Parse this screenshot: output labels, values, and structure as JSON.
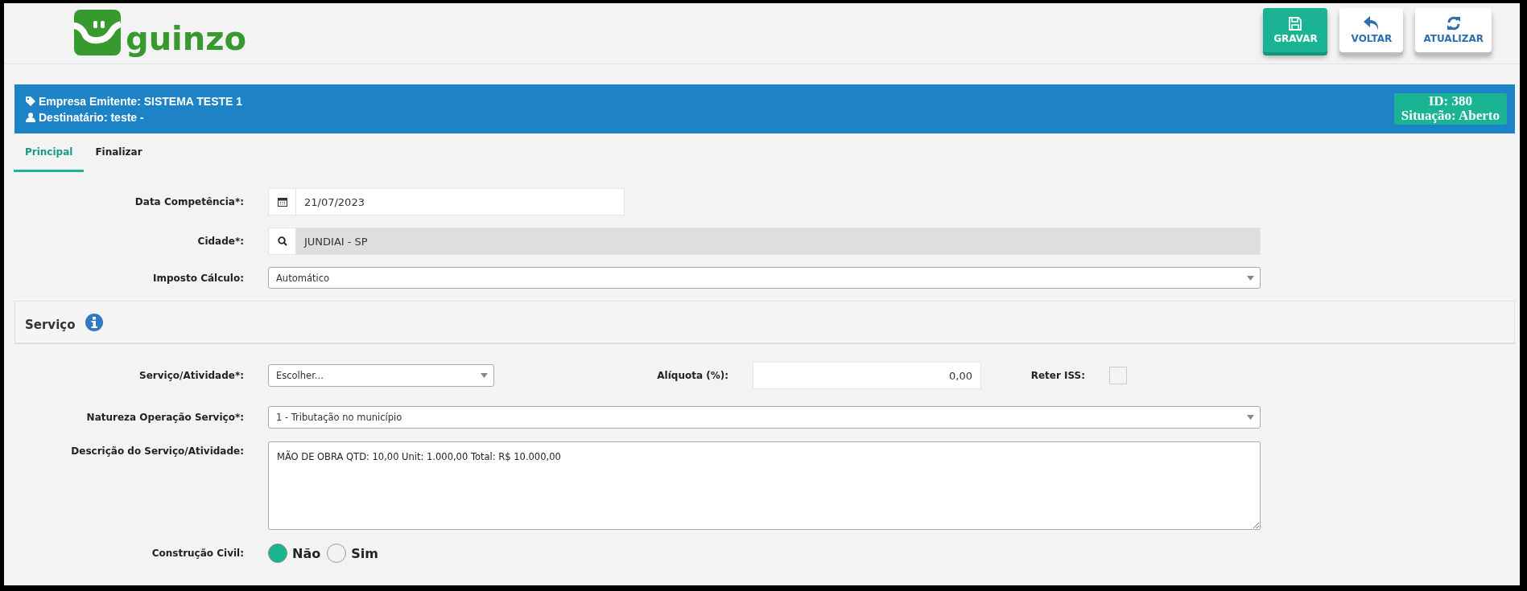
{
  "logo": {
    "text": "guinzo"
  },
  "toolbar": [
    {
      "label": "GRAVAR",
      "kind": "primary"
    },
    {
      "label": "VOLTAR",
      "kind": "default"
    },
    {
      "label": "ATUALIZAR",
      "kind": "default"
    }
  ],
  "info_bar": {
    "emitter": "Empresa Emitente: SISTEMA TESTE 1",
    "recipient": "Destinatário: teste -",
    "id": "ID: 380",
    "status": "Situação: Aberto"
  },
  "tabs": [
    {
      "label": "Principal",
      "selected": true
    },
    {
      "label": "Finalizar",
      "selected": false
    }
  ],
  "fields": [
    {
      "kind": "date",
      "label": "Data Competência*:",
      "value": "21/07/2023",
      "disabled": false
    },
    {
      "kind": "lookup",
      "label": "Cidade*:",
      "value": "JUNDIAI - SP",
      "disabled": true
    },
    {
      "kind": "select",
      "label": "Imposto Cálculo:",
      "value": "Automático",
      "disabled": false
    }
  ],
  "service_section": {
    "title": "Serviço"
  },
  "service_row": {
    "activity": {
      "label": "Serviço/Atividade*:",
      "value": "Escolher..."
    },
    "rate": {
      "label": "Alíquota (%):",
      "value": "0,00"
    },
    "withhold": {
      "label": "Reter ISS:",
      "checked": false
    }
  },
  "nature": {
    "label": "Natureza Operação Serviço*:",
    "value": "1 - Tributação no município"
  },
  "description": {
    "label": "Descrição do Serviço/Atividade:",
    "value": "MÃO DE OBRA QTD: 10,00 Unit: 1.000,00 Total: R$ 10.000,00"
  },
  "construction": {
    "label": "Construção Civil:",
    "options": [
      {
        "label": "Não",
        "selected": true
      },
      {
        "label": "Sim",
        "selected": false
      }
    ]
  }
}
